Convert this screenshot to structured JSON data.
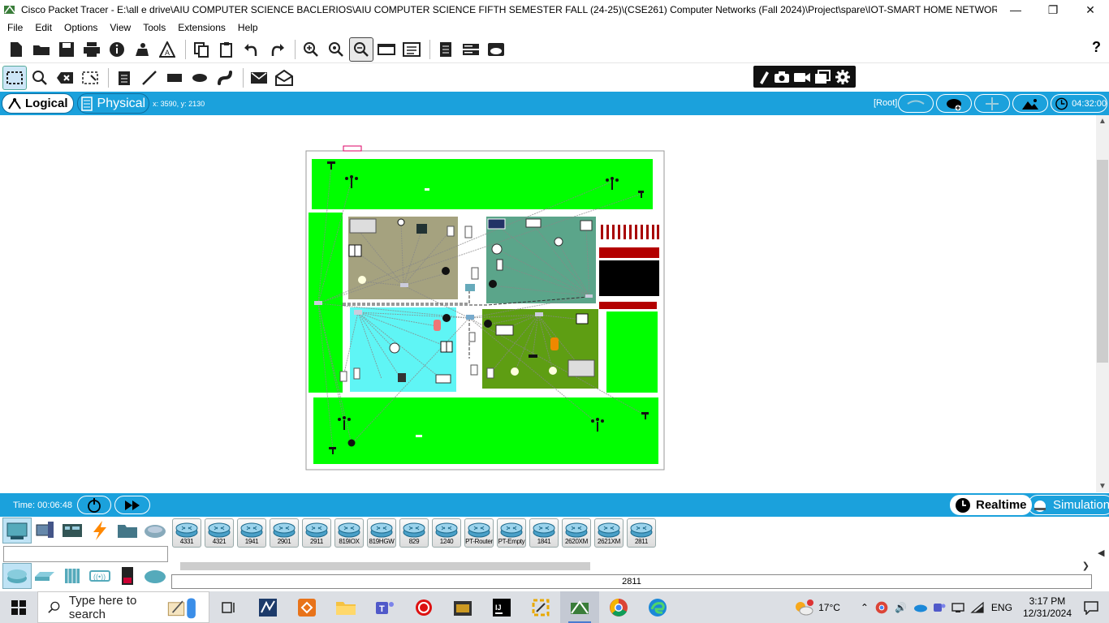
{
  "window": {
    "title": "Cisco Packet Tracer - E:\\all e drive\\AIU COMPUTER SCIENCE BACLERIOS\\AIU COMPUTER SCIENCE FIFTH SEMESTER FALL (24-25)\\(CSE261) Computer Networks (Fall 2024)\\Project\\spare\\IOT-SMART HOME NETWORK-FINAL.pkt",
    "controls": [
      "minimize-icon",
      "restore-icon",
      "close-icon"
    ]
  },
  "menu": {
    "items": [
      "File",
      "Edit",
      "Options",
      "View",
      "Tools",
      "Extensions",
      "Help"
    ]
  },
  "toolbar": {
    "help": "?"
  },
  "modebar": {
    "logical": "Logical",
    "physical": "Physical",
    "coords": "x: 3590, y: 2130",
    "root": "[Root]",
    "clock": "04:32:00"
  },
  "timebar": {
    "time": "Time: 00:06:48",
    "realtime": "Realtime",
    "simulation": "Simulation"
  },
  "devices": {
    "items": [
      "4331",
      "4321",
      "1941",
      "2901",
      "2911",
      "819IOX",
      "819HGW",
      "829",
      "1240",
      "PT-Router",
      "PT-Empty",
      "1841",
      "2620XM",
      "2621XM",
      "2811"
    ],
    "selected_caption": "2811"
  },
  "taskbar": {
    "search_placeholder": "Type here to search",
    "weather": "17°C",
    "language": "ENG",
    "time": "3:17 PM",
    "date": "12/31/2024"
  },
  "colors": {
    "accent": "#1ba1dc",
    "room_green": "#00ff00",
    "room_olive": "#a5a27f",
    "room_teal": "#5ba58a",
    "room_cyan": "#5ff5f5",
    "room_darkgreen": "#5e9e13"
  }
}
